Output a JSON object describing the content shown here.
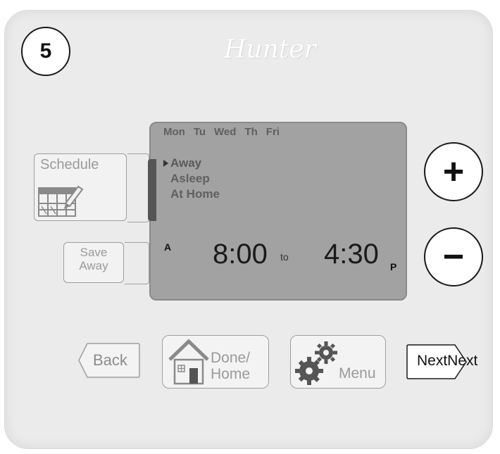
{
  "step_number": "5",
  "brand": "Hunter",
  "display": {
    "days": [
      "Mon",
      "Tu",
      "Wed",
      "Th",
      "Fri"
    ],
    "modes": [
      {
        "label": "Away",
        "selected": true
      },
      {
        "label": "Asleep",
        "selected": false
      },
      {
        "label": "At Home",
        "selected": false
      }
    ],
    "start_meridiem": "A",
    "start_time": "8:00",
    "to_label": "to",
    "end_time": "4:30",
    "end_meridiem": "P"
  },
  "buttons": {
    "schedule": "Schedule",
    "save_away_line1": "Save",
    "save_away_line2": "Away",
    "plus": "+",
    "minus": "−",
    "back": "Back",
    "done_home_line1": "Done/",
    "done_home_line2": "Home",
    "menu": "Menu",
    "next": "NextNext"
  },
  "icons": {
    "schedule": "calendar-pencil-icon",
    "done_home": "house-icon",
    "menu": "gears-icon"
  }
}
